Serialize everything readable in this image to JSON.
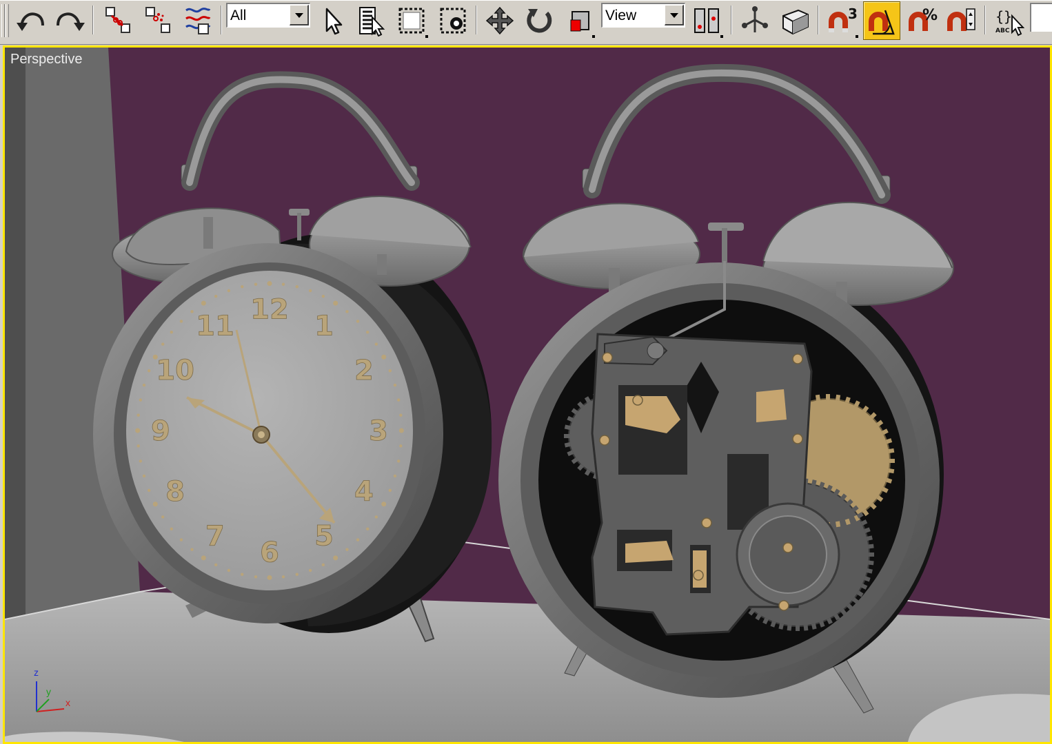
{
  "toolbar": {
    "selection_filter": {
      "value": "All"
    },
    "reference_coordinate_system": {
      "value": "View"
    },
    "angle_snap_superscript": "3",
    "percent_snap_symbol": "%",
    "named_selection_label": "ABC",
    "buttons": [
      {
        "name": "undo",
        "icon": "undo-icon"
      },
      {
        "name": "redo",
        "icon": "redo-icon"
      },
      {
        "name": "select-and-link",
        "icon": "link-icon"
      },
      {
        "name": "unlink-selection",
        "icon": "unlink-icon"
      },
      {
        "name": "bind-to-space-warp",
        "icon": "space-warp-icon"
      },
      {
        "name": "select-object",
        "icon": "arrow-cursor-icon"
      },
      {
        "name": "select-by-name",
        "icon": "select-by-name-icon"
      },
      {
        "name": "rectangular-selection-region",
        "icon": "rect-region-icon"
      },
      {
        "name": "window-crossing",
        "icon": "window-crossing-icon"
      },
      {
        "name": "select-and-move",
        "icon": "move-icon"
      },
      {
        "name": "select-and-rotate",
        "icon": "rotate-icon"
      },
      {
        "name": "select-and-scale",
        "icon": "scale-icon"
      },
      {
        "name": "use-pivot-point-center",
        "icon": "pivot-center-icon"
      },
      {
        "name": "select-and-manipulate",
        "icon": "manipulate-icon"
      },
      {
        "name": "keyboard-shortcut-override",
        "icon": "keyboard-override-icon"
      },
      {
        "name": "snaps-toggle",
        "icon": "snap-magnet-icon"
      },
      {
        "name": "angle-snap-toggle",
        "icon": "angle-snap-icon",
        "active": true
      },
      {
        "name": "percent-snap-toggle",
        "icon": "percent-snap-icon"
      },
      {
        "name": "spinner-snap-toggle",
        "icon": "spinner-snap-icon"
      },
      {
        "name": "edit-named-selection-sets",
        "icon": "named-selection-icon"
      }
    ]
  },
  "viewport": {
    "label": "Perspective",
    "active_border_color": "#ffe600",
    "background_color": "#512a48",
    "axis_tripod": {
      "x": "x",
      "y": "y",
      "z": "z"
    }
  },
  "scene": {
    "left_clock": {
      "dial_numbers": [
        "12",
        "1",
        "2",
        "3",
        "4",
        "5",
        "6",
        "7",
        "8",
        "9",
        "10",
        "11"
      ],
      "numeral_color": "#b9a47a"
    },
    "right_clock": {
      "description_icon": "clock-movement-gears",
      "brass_color": "#c6a570"
    }
  }
}
